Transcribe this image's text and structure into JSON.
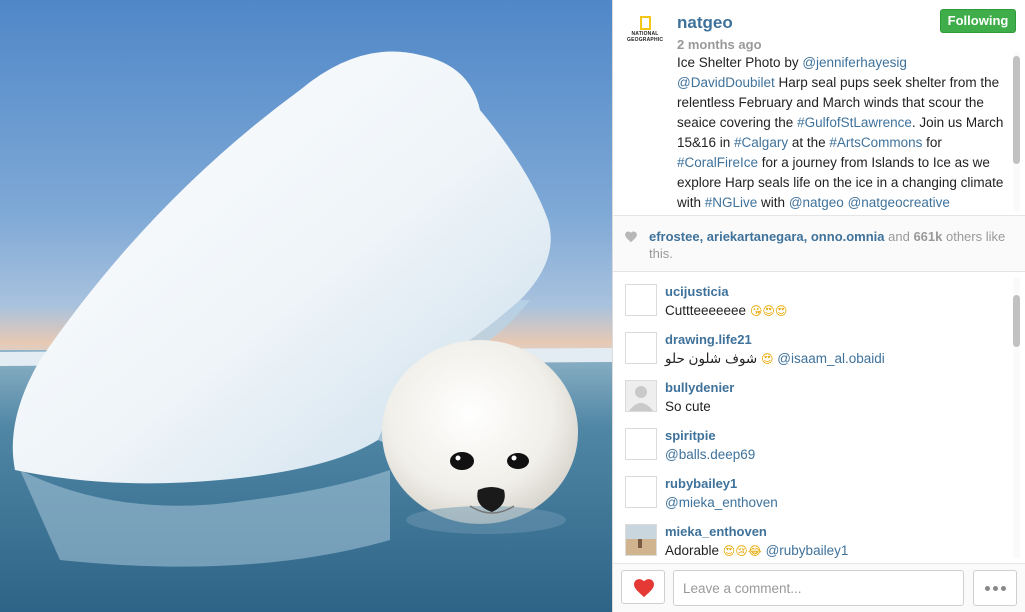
{
  "photo": {
    "alt_icon": "harp-seal-photo"
  },
  "header": {
    "brand_line1": "NATIONAL",
    "brand_line2": "GEOGRAPHIC",
    "username": "natgeo",
    "time_ago": "2 months ago",
    "follow_label": "Following",
    "follow_color": "#3fad4a"
  },
  "caption": {
    "t1": "Ice Shelter Photo by ",
    "m1": "@jenniferhayesig",
    "t2": " ",
    "m2": "@DavidDoubilet",
    "t3": " Harp seal pups seek shelter from the relentless February and March winds that scour the seaice covering the ",
    "h1": "#GulfofStLawrence",
    "t4": ". Join us March 15&16 in ",
    "h2": "#Calgary",
    "t5": " at the ",
    "h3": "#ArtsCommons",
    "t6": " for ",
    "h4": "#CoralFireIce",
    "t7": " for a journey from Islands to Ice as we explore Harp seals life on the ice in a changing climate with ",
    "h5": "#NGLive",
    "t8": " with ",
    "m3": "@natgeo",
    "t9": " ",
    "m4": "@natgeocreative"
  },
  "likes": {
    "names": "efrostee, ariekartanegara, onno.omnia",
    "and": " and ",
    "count": "661k",
    "suffix": " others like this."
  },
  "comments": [
    {
      "user": "ucijusticia",
      "text": "Cuttteeeeeee ",
      "emoji": "😘😍😍",
      "mention": ""
    },
    {
      "user": "drawing.life21",
      "text": "شوف شلون حلو ",
      "emoji": "😍",
      "mention": " @isaam_al.obaidi"
    },
    {
      "user": "bullydenier",
      "text": "So cute",
      "emoji": "",
      "mention": ""
    },
    {
      "user": "spiritpie",
      "text": "",
      "emoji": "",
      "mention": "@balls.deep69"
    },
    {
      "user": "rubybailey1",
      "text": "",
      "emoji": "",
      "mention": "@mieka_enthoven"
    },
    {
      "user": "mieka_enthoven",
      "text": "Adorable ",
      "emoji": "😍😢😂",
      "mention": " @rubybailey1"
    }
  ],
  "footer": {
    "comment_placeholder": "Leave a comment...",
    "like_color": "#e53935"
  },
  "colors": {
    "link": "#3f729b",
    "muted": "#999999"
  }
}
